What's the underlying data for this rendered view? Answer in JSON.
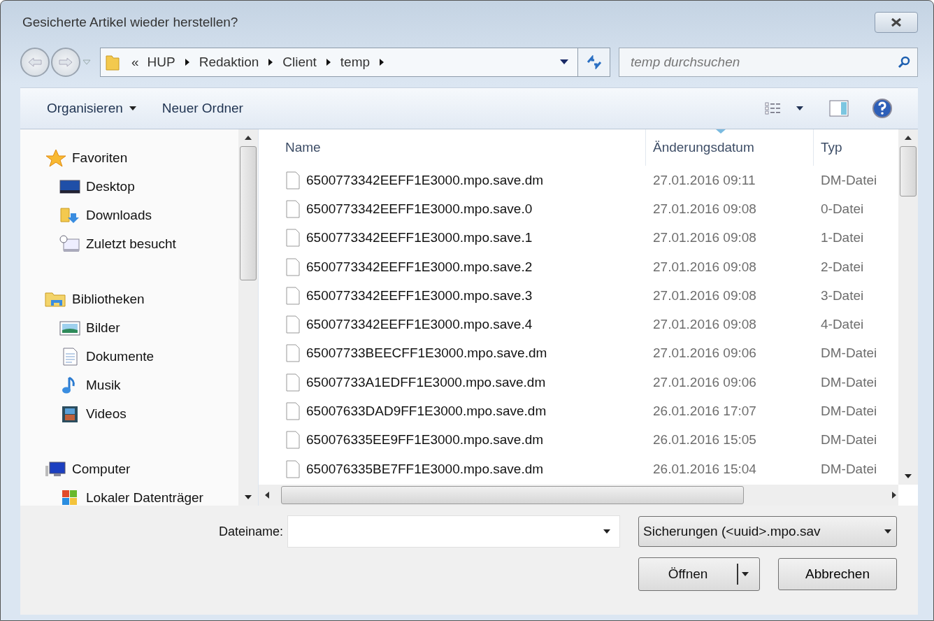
{
  "window": {
    "title": "Gesicherte Artikel wieder herstellen?"
  },
  "breadcrumb": {
    "overflow": "«",
    "segments": [
      "HUP",
      "Redaktion",
      "Client",
      "temp"
    ]
  },
  "search": {
    "placeholder": "temp durchsuchen"
  },
  "toolbar": {
    "organize": "Organisieren",
    "new_folder": "Neuer Ordner"
  },
  "sidebar": {
    "groups": [
      {
        "label": "Favoriten",
        "children": [
          "Desktop",
          "Downloads",
          "Zuletzt besucht"
        ]
      },
      {
        "label": "Bibliotheken",
        "children": [
          "Bilder",
          "Dokumente",
          "Musik",
          "Videos"
        ]
      },
      {
        "label": "Computer",
        "children": [
          "Lokaler Datenträger"
        ]
      }
    ]
  },
  "table": {
    "columns": [
      {
        "label": "Name",
        "sorted": false
      },
      {
        "label": "Änderungsdatum",
        "sorted": true
      },
      {
        "label": "Typ",
        "sorted": false
      }
    ],
    "rows": [
      [
        "6500773342EEFF1E3000.mpo.save.dm",
        "27.01.2016 09:11",
        "DM-Datei"
      ],
      [
        "6500773342EEFF1E3000.mpo.save.0",
        "27.01.2016 09:08",
        "0-Datei"
      ],
      [
        "6500773342EEFF1E3000.mpo.save.1",
        "27.01.2016 09:08",
        "1-Datei"
      ],
      [
        "6500773342EEFF1E3000.mpo.save.2",
        "27.01.2016 09:08",
        "2-Datei"
      ],
      [
        "6500773342EEFF1E3000.mpo.save.3",
        "27.01.2016 09:08",
        "3-Datei"
      ],
      [
        "6500773342EEFF1E3000.mpo.save.4",
        "27.01.2016 09:08",
        "4-Datei"
      ],
      [
        "65007733BEECFF1E3000.mpo.save.dm",
        "27.01.2016 09:06",
        "DM-Datei"
      ],
      [
        "65007733A1EDFF1E3000.mpo.save.dm",
        "27.01.2016 09:06",
        "DM-Datei"
      ],
      [
        "65007633DAD9FF1E3000.mpo.save.dm",
        "26.01.2016 17:07",
        "DM-Datei"
      ],
      [
        "650076335EE9FF1E3000.mpo.save.dm",
        "26.01.2016 15:05",
        "DM-Datei"
      ],
      [
        "650076335BE7FF1E3000.mpo.save.dm",
        "26.01.2016 15:04",
        "DM-Datei"
      ]
    ]
  },
  "footer": {
    "filename_label": "Dateiname:",
    "filter": "Sicherungen (<uuid>.mpo.sav",
    "open": "Öffnen",
    "cancel": "Abbrechen"
  }
}
